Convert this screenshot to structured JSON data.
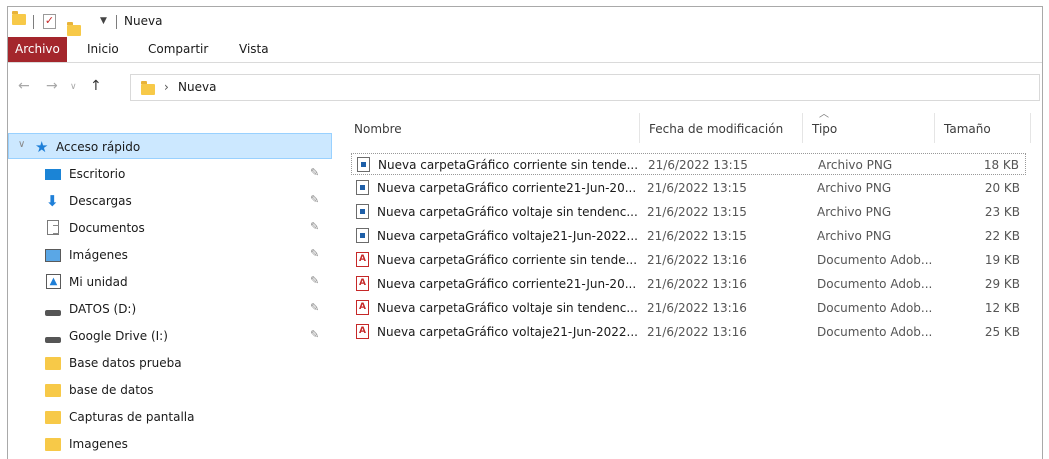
{
  "window": {
    "title": "Nueva"
  },
  "ribbon": {
    "tabs": [
      "Archivo",
      "Inicio",
      "Compartir",
      "Vista"
    ],
    "active": "Archivo"
  },
  "address": {
    "path": "Nueva"
  },
  "sidebar": {
    "items": [
      {
        "label": "Acceso rápido",
        "icon": "star-icon",
        "pinned": false
      },
      {
        "label": "Escritorio",
        "icon": "desktop-icon",
        "pinned": true
      },
      {
        "label": "Descargas",
        "icon": "download-icon",
        "pinned": true
      },
      {
        "label": "Documentos",
        "icon": "documents-icon",
        "pinned": true
      },
      {
        "label": "Imágenes",
        "icon": "pictures-icon",
        "pinned": true
      },
      {
        "label": "Mi unidad",
        "icon": "google-drive-icon",
        "pinned": true
      },
      {
        "label": "DATOS (D:)",
        "icon": "drive-icon",
        "pinned": true
      },
      {
        "label": "Google Drive (I:)",
        "icon": "drive-icon",
        "pinned": true
      },
      {
        "label": "Base datos prueba",
        "icon": "folder-icon",
        "pinned": false
      },
      {
        "label": "base de datos",
        "icon": "folder-icon",
        "pinned": false
      },
      {
        "label": "Capturas de pantalla",
        "icon": "folder-icon",
        "pinned": false
      },
      {
        "label": "Imagenes",
        "icon": "folder-icon",
        "pinned": false
      }
    ]
  },
  "columns": {
    "name": "Nombre",
    "date": "Fecha de modificación",
    "type": "Tipo",
    "size": "Tamaño"
  },
  "files": [
    {
      "name": "Nueva carpetaGráfico corriente sin tende...",
      "date": "21/6/2022 13:15",
      "type": "Archivo PNG",
      "size": "18 KB",
      "kind": "png"
    },
    {
      "name": "Nueva carpetaGráfico corriente21-Jun-20...",
      "date": "21/6/2022 13:15",
      "type": "Archivo PNG",
      "size": "20 KB",
      "kind": "png"
    },
    {
      "name": "Nueva carpetaGráfico voltaje sin tendenc...",
      "date": "21/6/2022 13:15",
      "type": "Archivo PNG",
      "size": "23 KB",
      "kind": "png"
    },
    {
      "name": "Nueva carpetaGráfico voltaje21-Jun-2022...",
      "date": "21/6/2022 13:15",
      "type": "Archivo PNG",
      "size": "22 KB",
      "kind": "png"
    },
    {
      "name": "Nueva carpetaGráfico corriente sin tende...",
      "date": "21/6/2022 13:16",
      "type": "Documento Adob...",
      "size": "19 KB",
      "kind": "pdf"
    },
    {
      "name": "Nueva carpetaGráfico corriente21-Jun-20...",
      "date": "21/6/2022 13:16",
      "type": "Documento Adob...",
      "size": "29 KB",
      "kind": "pdf"
    },
    {
      "name": "Nueva carpetaGráfico voltaje sin tendenc...",
      "date": "21/6/2022 13:16",
      "type": "Documento Adob...",
      "size": "12 KB",
      "kind": "pdf"
    },
    {
      "name": "Nueva carpetaGráfico voltaje21-Jun-2022...",
      "date": "21/6/2022 13:16",
      "type": "Documento Adob...",
      "size": "25 KB",
      "kind": "pdf"
    }
  ]
}
